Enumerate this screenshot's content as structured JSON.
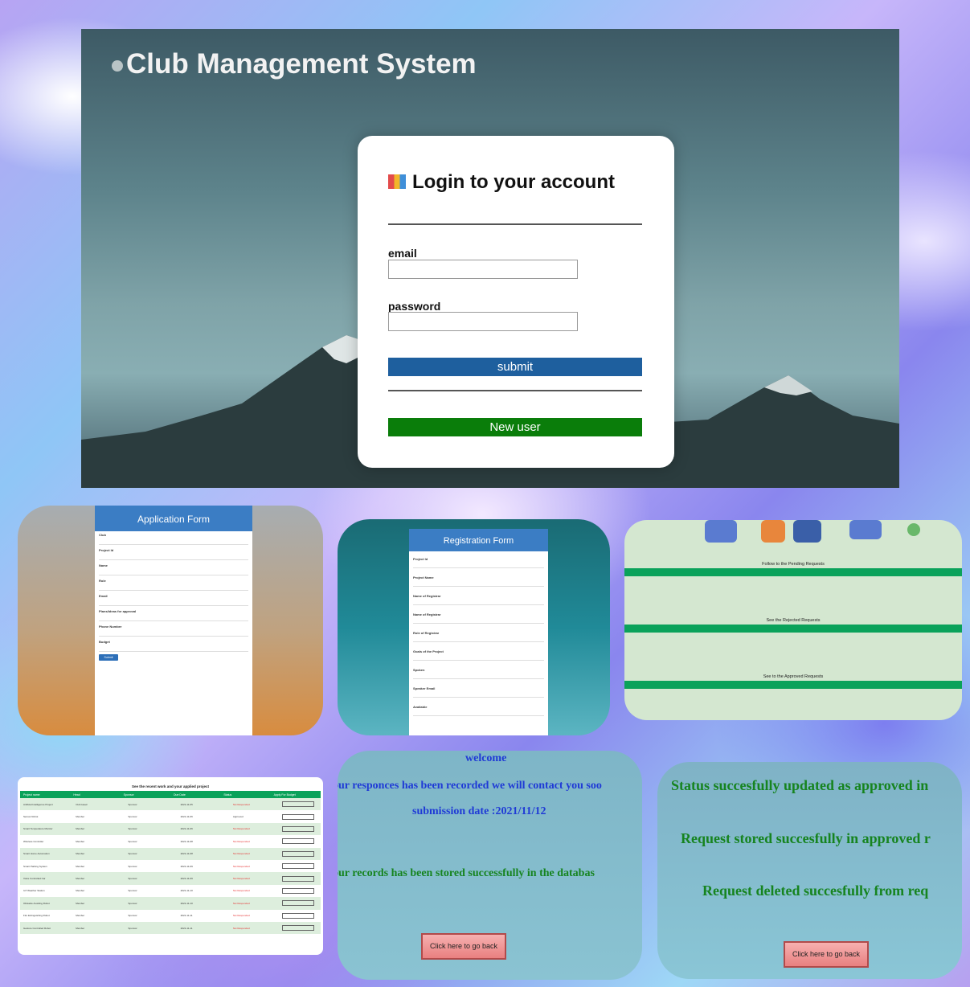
{
  "login": {
    "app_title": "Club Management System",
    "card_heading": "Login to your account",
    "email_label": "email",
    "password_label": "password",
    "submit_label": "submit",
    "new_user_label": "New user"
  },
  "application_form": {
    "heading": "Application Form",
    "fields": [
      "Club",
      "Project Id",
      "Name",
      "Role",
      "Email",
      "Plans/ideas for approval",
      "Phone Number",
      "Budget"
    ],
    "submit_label": "Submit"
  },
  "registration_form": {
    "heading": "Registration Form",
    "fields": [
      "Project Id",
      "Project Name",
      "Name of Registrar",
      "Name of Registrar",
      "Role of Registrar",
      "Goals of the Project",
      "Spoken",
      "Speaker Email",
      "Available"
    ]
  },
  "requests_screen": {
    "pending_title": "Follow to the Pending Requests",
    "rejected_title": "See the Rejected Requests",
    "approved_title": "See to the Approved Requests"
  },
  "projects_table": {
    "title": "See the recent work and your applied project",
    "columns": [
      "Project name",
      "Head",
      "Sponsor",
      "Due Date",
      "Status",
      "Apply For Budget"
    ],
    "rows": [
      [
        "Artificial Intelligence Project",
        "Club Head",
        "Sponsor",
        "2021-11-05",
        "Not Responded"
      ],
      [
        "Sensor Robot",
        "Member",
        "Sponsor",
        "2021-11-06",
        "Approved"
      ],
      [
        "Smart Temperature Monitor",
        "Member",
        "Sponsor",
        "2021-11-06",
        "Not Responded"
      ],
      [
        "Wireless Controller",
        "Member",
        "Sponsor",
        "2021-11-08",
        "Not Responded"
      ],
      [
        "Smart Home Automation",
        "Member",
        "Sponsor",
        "2021-11-08",
        "Not Responded"
      ],
      [
        "Smart Parking System",
        "Member",
        "Sponsor",
        "2021-11-09",
        "Not Responded"
      ],
      [
        "Voice Controlled Car",
        "Member",
        "Sponsor",
        "2021-11-09",
        "Not Responded"
      ],
      [
        "IoT Weather Station",
        "Member",
        "Sponsor",
        "2021-11-10",
        "Not Responded"
      ],
      [
        "Obstacle Avoiding Robot",
        "Member",
        "Sponsor",
        "2021-11-10",
        "Not Responded"
      ],
      [
        "Fire Extinguishing Robot",
        "Member",
        "Sponsor",
        "2021-11-11",
        "Not Responded"
      ],
      [
        "Gesture Controlled Robot",
        "Member",
        "Sponsor",
        "2021-11-11",
        "Not Responded"
      ]
    ]
  },
  "message_screen_1": {
    "welcome": "welcome",
    "line1": "our responces has been recorded we will contact you soo",
    "line2": "submission date :2021/11/12",
    "line3": "our records has been stored successfully in the databas",
    "back_label": "Click here to go back"
  },
  "message_screen_2": {
    "line1": "Status succesfully updated as approved in",
    "line2": "Request stored succesfully in approved r",
    "line3": "Request deleted succesfully from req",
    "back_label": "Click here to go back"
  }
}
